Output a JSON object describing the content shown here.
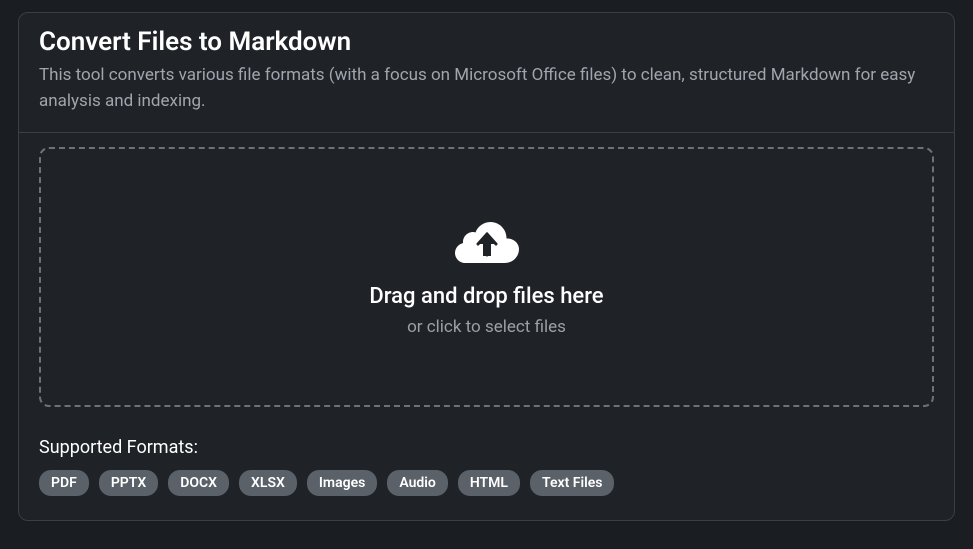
{
  "header": {
    "title": "Convert Files to Markdown",
    "description": "This tool converts various file formats (with a focus on Microsoft Office files) to clean, structured Markdown for easy analysis and indexing."
  },
  "dropzone": {
    "primary": "Drag and drop files here",
    "secondary": "or click to select files"
  },
  "formats": {
    "label": "Supported Formats:",
    "items": [
      "PDF",
      "PPTX",
      "DOCX",
      "XLSX",
      "Images",
      "Audio",
      "HTML",
      "Text Files"
    ]
  }
}
